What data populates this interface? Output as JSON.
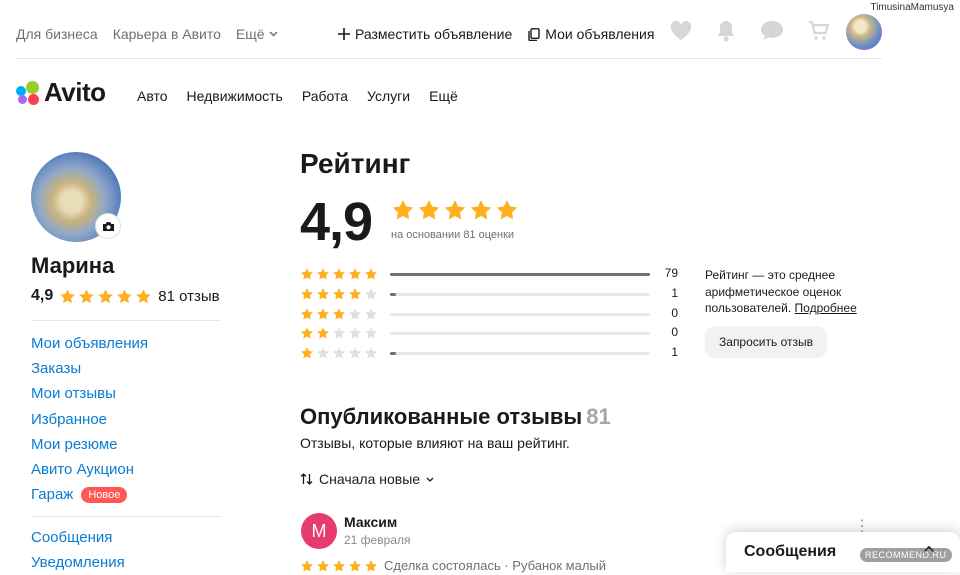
{
  "watermark": "TimusinaMamusya",
  "topbar": {
    "links": [
      "Для бизнеса",
      "Карьера в Авито",
      "Ещё"
    ],
    "post_ad": "Разместить объявление",
    "my_ads": "Мои объявления"
  },
  "logo": {
    "text": "Avito"
  },
  "mainnav": [
    "Авто",
    "Недвижимость",
    "Работа",
    "Услуги",
    "Ещё"
  ],
  "profile": {
    "name": "Марина",
    "rating": "4,9",
    "rating_stars": 4.9,
    "reviews": "81 отзыв"
  },
  "sidebar": {
    "menu1": [
      "Мои объявления",
      "Заказы",
      "Мои отзывы",
      "Избранное",
      "Мои резюме",
      "Авито Аукцион",
      "Гараж"
    ],
    "new_badge": "Новое",
    "menu2": [
      "Сообщения",
      "Уведомления"
    ]
  },
  "rating": {
    "title": "Рейтинг",
    "score": "4,9",
    "based_on": "на основании 81 оценки",
    "distribution": [
      {
        "stars": 5,
        "count": 79
      },
      {
        "stars": 4,
        "count": 1
      },
      {
        "stars": 3,
        "count": 0
      },
      {
        "stars": 2,
        "count": 0
      },
      {
        "stars": 1,
        "count": 1
      }
    ],
    "explain_text": "Рейтинг — это среднее арифметическое оценок пользователей.",
    "explain_link": "Подробнее",
    "request_button": "Запросить отзыв"
  },
  "reviews": {
    "title": "Опубликованные отзывы",
    "count": "81",
    "subtitle": "Отзывы, которые влияют на ваш рейтинг.",
    "sort": "Сначала новые",
    "first": {
      "initial": "М",
      "name": "Максим",
      "date": "21 февраля",
      "text": "Сделка состоялась · Рубанок малый"
    }
  },
  "messages_popup": {
    "title": "Сообщения"
  },
  "recommend_badge": "RECOMMEND.RU",
  "colors": {
    "star": "#ffb021",
    "star_empty": "#e0e0e0",
    "link": "#0a7cd1",
    "badge": "#ff5753",
    "review_avatar": "#e73a6e"
  }
}
